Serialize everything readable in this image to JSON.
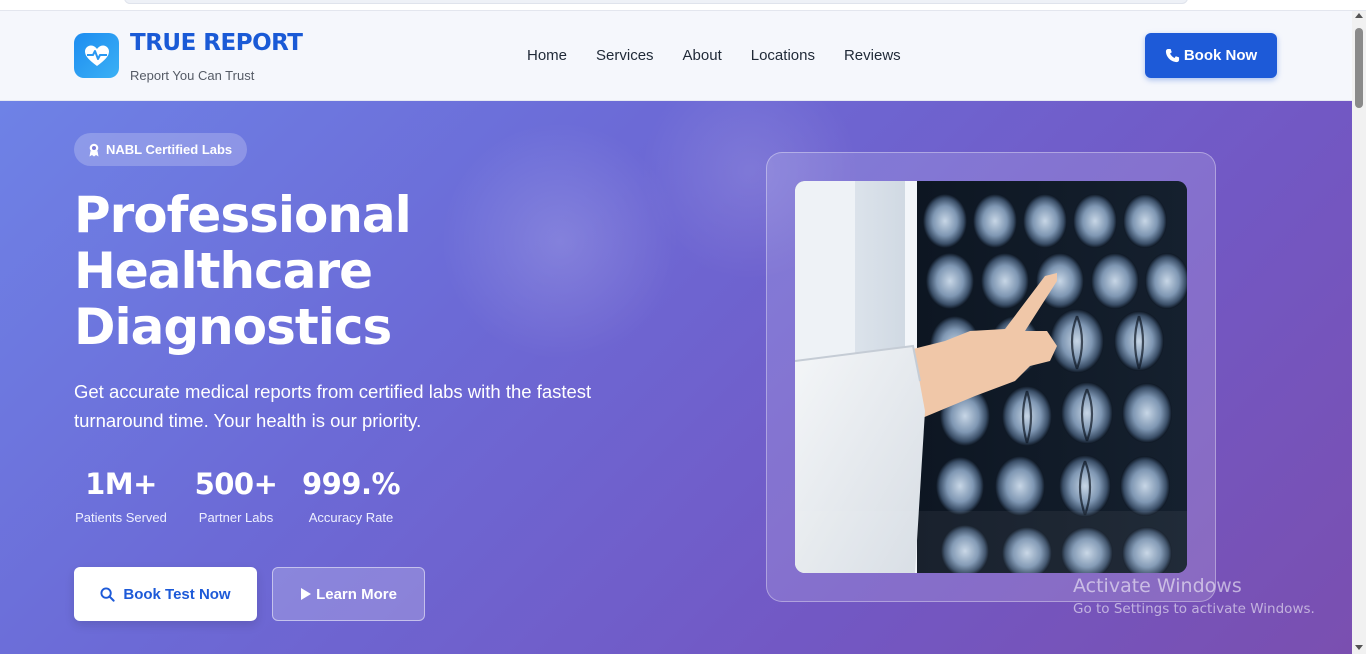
{
  "brand": {
    "title": "TRUE REPORT",
    "tagline": "Report You Can Trust",
    "logo_icon": "heart-pulse-icon"
  },
  "nav": {
    "items": [
      {
        "label": "Home"
      },
      {
        "label": "Services"
      },
      {
        "label": "About"
      },
      {
        "label": "Locations"
      },
      {
        "label": "Reviews"
      }
    ],
    "cta_label": "Book Now",
    "cta_icon": "phone-icon"
  },
  "hero": {
    "badge": "NABL Certified Labs",
    "badge_icon": "award-icon",
    "headline_line1": "Professional",
    "headline_line2": "Healthcare",
    "headline_line3": "Diagnostics",
    "description": "Get accurate medical reports from certified labs with the fastest turnaround time. Your health is our priority.",
    "stats": [
      {
        "value": "1M+",
        "label": "Patients Served"
      },
      {
        "value": "500+",
        "label": "Partner Labs"
      },
      {
        "value": "999.%",
        "label": "Accuracy Rate"
      }
    ],
    "primary_button": "Book Test Now",
    "primary_icon": "search-icon",
    "secondary_button": "Learn More",
    "secondary_icon": "play-icon",
    "image_subject": "doctor pointing at brain MRI scans"
  },
  "watermark": {
    "line1": "Activate Windows",
    "line2": "Go to Settings to activate Windows."
  },
  "colors": {
    "brand_blue": "#1d5ad8",
    "hero_gradient_start": "#6e82e6",
    "hero_gradient_end": "#7a4fb0"
  }
}
